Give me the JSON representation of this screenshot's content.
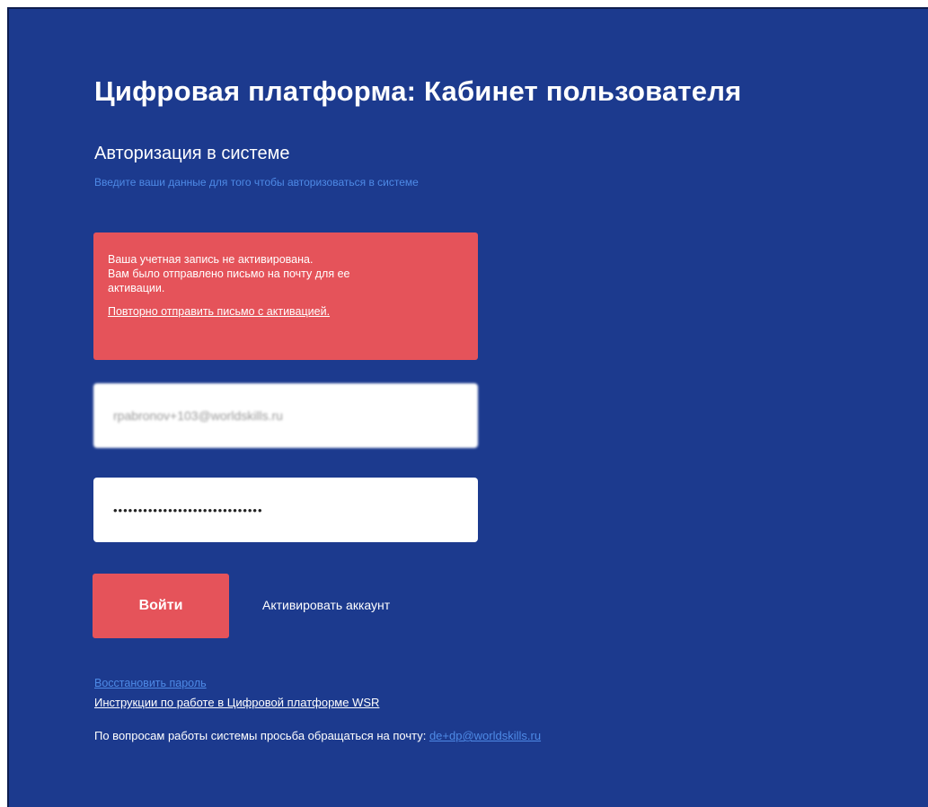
{
  "page": {
    "title": "Цифровая платформа: Кабинет пользователя",
    "subtitle": "Авторизация в системе",
    "description": "Введите ваши данные для того чтобы авторизоваться в системе"
  },
  "alert": {
    "lines": [
      "Ваша учетная запись не активирована.",
      "Вам было отправлено письмо на почту для ее",
      "активации."
    ],
    "resend_link": "Повторно отправить письмо с активацией."
  },
  "form": {
    "email_value": "rpabronov+103@worldskills.ru",
    "password_value": "••••••••••••••••••••••••••••••",
    "login_button": "Войти",
    "activate_link": "Активировать аккаунт"
  },
  "footer": {
    "restore_password": "Восстановить пароль",
    "instructions": "Инструкции по работе в Цифровой платформе WSR",
    "contact_text": "По вопросам работы системы просьба обращаться на почту: ",
    "contact_email": "de+dp@worldskills.ru"
  },
  "colors": {
    "background": "#1c3a8e",
    "accent": "#e5535a",
    "link": "#4e8ae6"
  }
}
